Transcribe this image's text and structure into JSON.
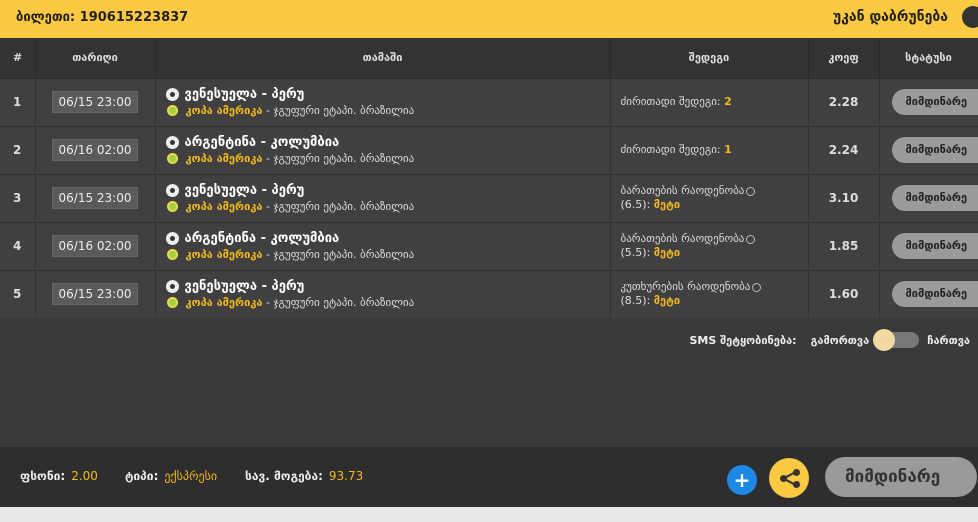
{
  "header": {
    "ticket_label": "ბილეთი:",
    "ticket_number": "190615223837",
    "back_label": "უკან დაბრუნება"
  },
  "table": {
    "columns": [
      "#",
      "თარიღი",
      "თამაში",
      "შედეგი",
      "კოეფ",
      "სტატუსი"
    ],
    "rows": [
      {
        "num": "1",
        "date": "06/15 23:00",
        "match": "ვენესუელა - პერუ",
        "league": "კოპა ამერიკა",
        "stage": "- ჯგუფური ეტაპი. ბრაზილია",
        "outcome_label": "ძირითადი შედეგი:",
        "outcome_value": "2",
        "odd": "2.28",
        "status": "მიმდინარე"
      },
      {
        "num": "2",
        "date": "06/16 02:00",
        "match": "არგენტინა - კოლუმბია",
        "league": "კოპა ამერიკა",
        "stage": "- ჯგუფური ეტაპი. ბრაზილია",
        "outcome_label": "ძირითადი შედეგი:",
        "outcome_value": "1",
        "odd": "2.24",
        "status": "მიმდინარე"
      },
      {
        "num": "3",
        "date": "06/15 23:00",
        "match": "ვენესუელა - პერუ",
        "league": "კოპა ამერიკა",
        "stage": "- ჯგუფური ეტაპი. ბრაზილია",
        "outcome_label": "ბარათების რაოდენობა",
        "outcome_extra": "(6.5):",
        "outcome_value": "მეტი",
        "odd": "3.10",
        "status": "მიმდინარე"
      },
      {
        "num": "4",
        "date": "06/16 02:00",
        "match": "არგენტინა - კოლუმბია",
        "league": "კოპა ამერიკა",
        "stage": "- ჯგუფური ეტაპი. ბრაზილია",
        "outcome_label": "ბარათების რაოდენობა",
        "outcome_extra": "(5.5):",
        "outcome_value": "მეტი",
        "odd": "1.85",
        "status": "მიმდინარე"
      },
      {
        "num": "5",
        "date": "06/15 23:00",
        "match": "ვენესუელა - პერუ",
        "league": "კოპა ამერიკა",
        "stage": "- ჯგუფური ეტაპი. ბრაზილია",
        "outcome_label": "კუთხურების რაოდენობა",
        "outcome_extra": "(8.5):",
        "outcome_value": "მეტი",
        "odd": "1.60",
        "status": "მიმდინარე"
      }
    ]
  },
  "sms": {
    "label": "SMS შეტყობინება:",
    "off_label": "გამორთვა",
    "on_label": "ჩართვა"
  },
  "footer": {
    "stake_label": "ფსონი:",
    "stake_value": "2.00",
    "type_label": "ტიპი:",
    "type_value": "ექსპრესი",
    "win_label": "სავ. მოგება:",
    "win_value": "93.73",
    "plus_label": "+",
    "status_button": "მიმდინარე"
  },
  "colors": {
    "accent": "#fdc943",
    "highlight": "#f5b820",
    "plus": "#1e88e5"
  }
}
